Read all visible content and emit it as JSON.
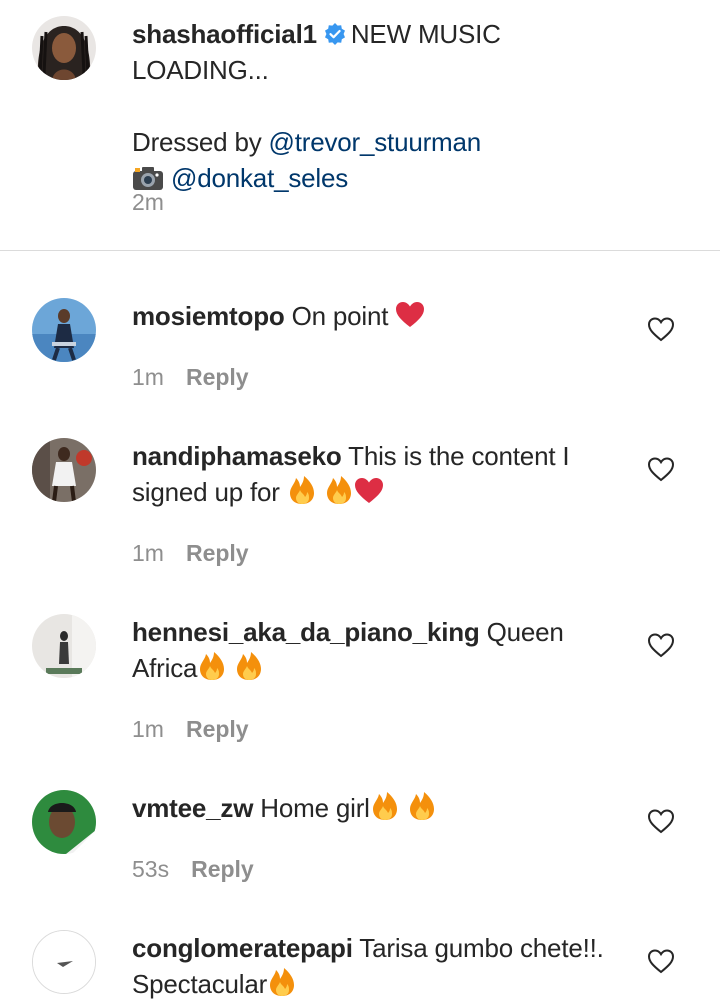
{
  "caption": {
    "username": "shashaofficial1",
    "headline": "NEW MUSIC LOADING...",
    "dressed_by_prefix": "Dressed by",
    "dressed_by_handle": "@trevor_stuurman",
    "camera_emoji": "camera-icon",
    "photo_handle": "@donkat_seles",
    "time": "2m"
  },
  "comments": [
    {
      "username": "mosiemtopo",
      "text": "On point",
      "emojis": [
        "red-heart"
      ],
      "time": "1m",
      "reply_label": "Reply"
    },
    {
      "username": "nandiphamaseko",
      "text": "This is the content I signed up for",
      "emojis": [
        "fire",
        "fire",
        "red-heart"
      ],
      "time": "1m",
      "reply_label": "Reply"
    },
    {
      "username": "hennesi_aka_da_piano_king",
      "text": "Queen Africa",
      "emojis": [
        "fire",
        "fire"
      ],
      "time": "1m",
      "reply_label": "Reply"
    },
    {
      "username": "vmtee_zw",
      "text": "Home girl",
      "emojis": [
        "fire",
        "fire"
      ],
      "time": "53s",
      "reply_label": "Reply"
    },
    {
      "username": "conglomeratepapi",
      "text": "Tarisa gumbo chete!!. Spectacular",
      "emojis": [
        "fire"
      ],
      "time": "",
      "reply_label": ""
    }
  ],
  "colors": {
    "link": "#00376b",
    "meta": "#8e8e8e",
    "verified": "#3897f0",
    "heart_emoji": "#e0245e",
    "divider": "#dbdbdb"
  }
}
